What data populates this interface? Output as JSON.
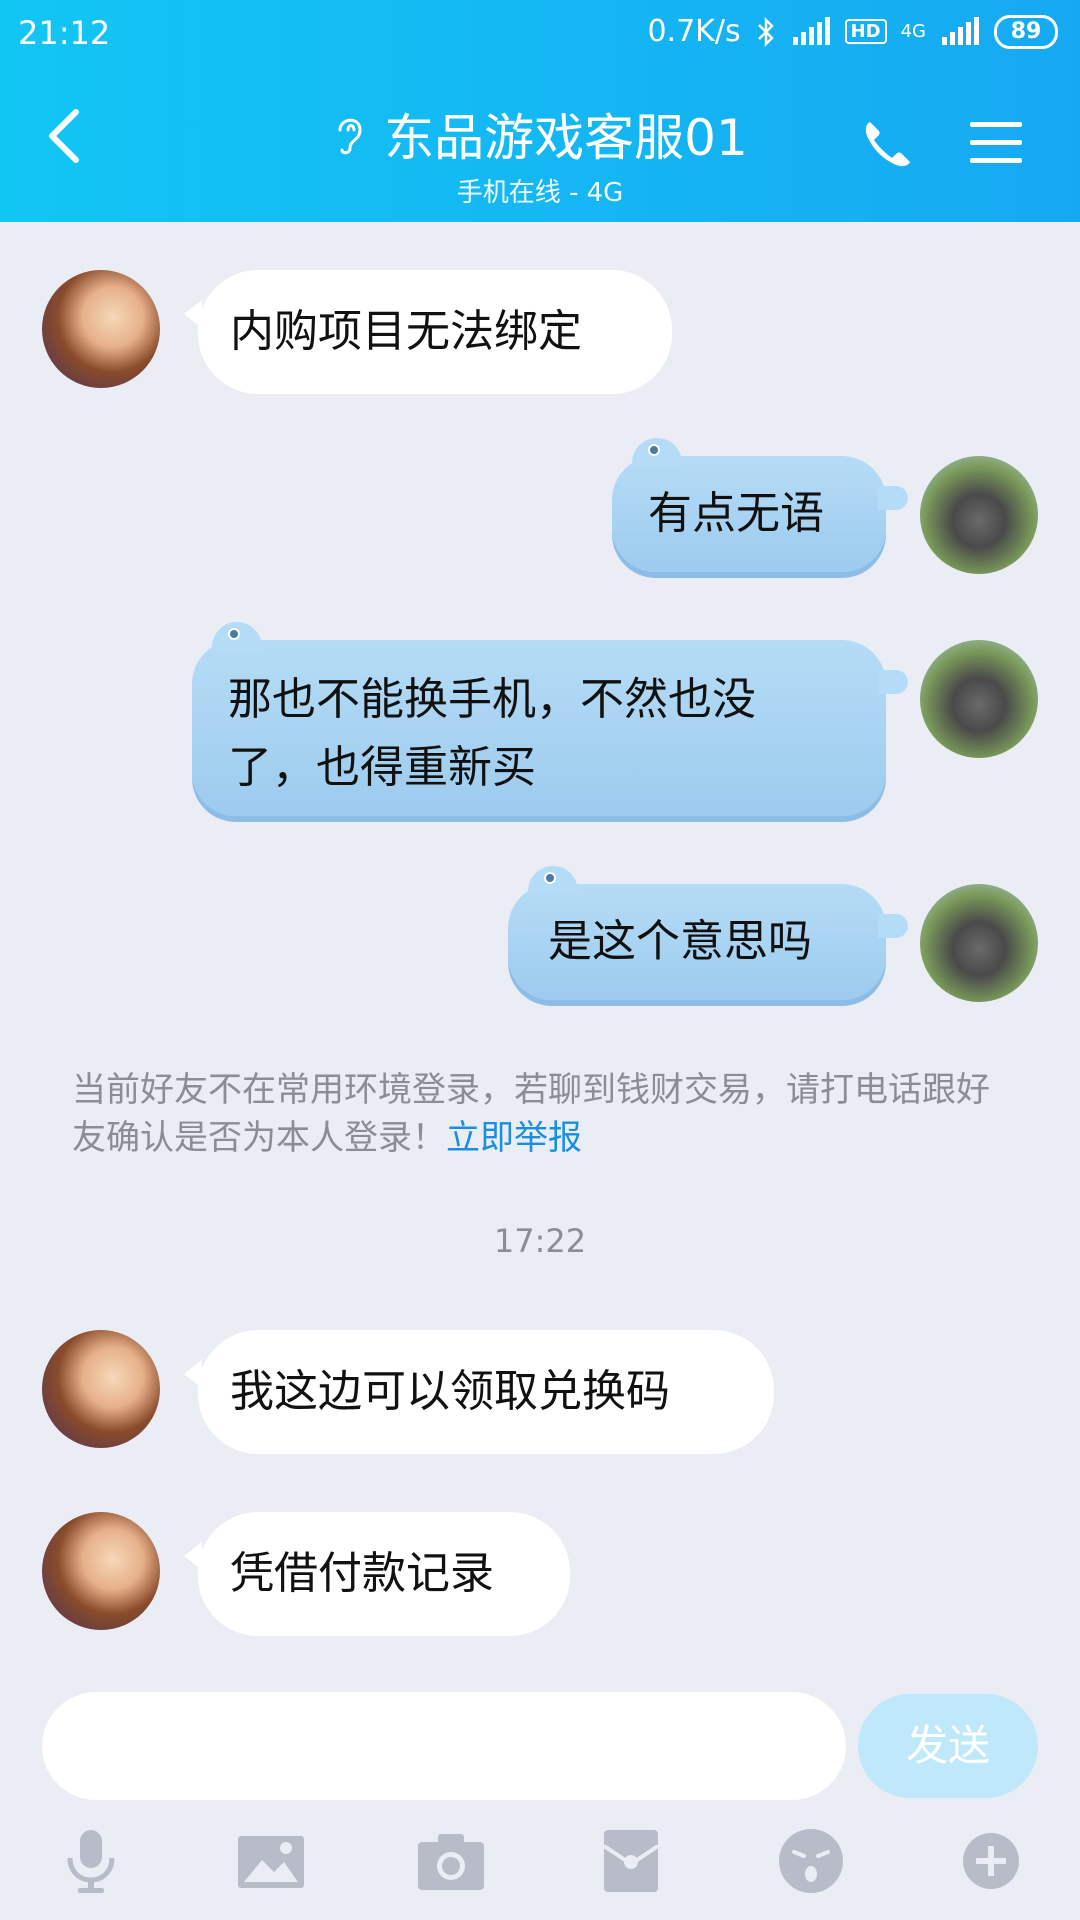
{
  "status_bar": {
    "time": "21:12",
    "network_speed": "0.7K/s",
    "hd": "HD",
    "network_type": "4G",
    "battery": "89"
  },
  "header": {
    "title": "东品游戏客服01",
    "subtitle": "手机在线 - 4G",
    "back_icon": "chevron-left-icon",
    "phone_icon": "phone-icon",
    "menu_icon": "menu-icon"
  },
  "messages": [
    {
      "side": "in",
      "text_lines": [
        "内购项目无法绑定"
      ]
    },
    {
      "side": "out",
      "text_lines": [
        "有点无语"
      ]
    },
    {
      "side": "out",
      "text_lines": [
        "那也不能换手机，不然也没",
        "了，也得重新买"
      ]
    },
    {
      "side": "out",
      "text_lines": [
        "是这个意思吗"
      ]
    },
    {
      "side": "in",
      "text_lines": [
        "我这边可以领取兑换码"
      ]
    },
    {
      "side": "in",
      "text_lines": [
        "凭借付款记录"
      ]
    }
  ],
  "notice": {
    "text": "当前好友不在常用环境登录，若聊到钱财交易，请打电话跟好友确认是否为本人登录！",
    "link": "立即举报"
  },
  "timestamp": "17:22",
  "input": {
    "value": "",
    "send_label": "发送"
  },
  "toolbar": [
    "microphone-icon",
    "image-icon",
    "camera-icon",
    "red-packet-icon",
    "emoji-icon",
    "plus-icon"
  ],
  "colors": {
    "header_start": "#12c6f4",
    "header_end": "#16a9f2",
    "chat_bg": "#ebedf5",
    "outgoing_bubble": "#b5dcf6",
    "link": "#1a8fe0",
    "send_button": "#bfe9fb"
  }
}
